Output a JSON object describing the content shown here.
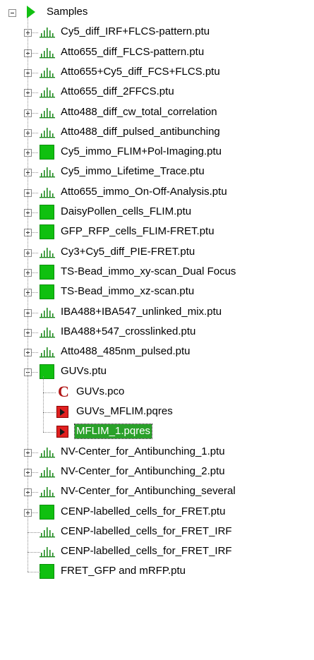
{
  "tree": {
    "root": {
      "label": "Samples",
      "expanded": true,
      "icon": "play-triangle-icon"
    },
    "items": [
      {
        "label": "Cy5_diff_IRF+FLCS-pattern.ptu",
        "icon": "histogram-icon"
      },
      {
        "label": "Atto655_diff_FLCS-pattern.ptu",
        "icon": "histogram-icon"
      },
      {
        "label": "Atto655+Cy5_diff_FCS+FLCS.ptu",
        "icon": "histogram-icon"
      },
      {
        "label": "Atto655_diff_2FFCS.ptu",
        "icon": "histogram-icon"
      },
      {
        "label": "Atto488_diff_cw_total_correlation",
        "icon": "histogram-icon"
      },
      {
        "label": "Atto488_diff_pulsed_antibunching",
        "icon": "histogram-icon"
      },
      {
        "label": "Cy5_immo_FLIM+Pol-Imaging.ptu",
        "icon": "image-icon"
      },
      {
        "label": "Cy5_immo_Lifetime_Trace.ptu",
        "icon": "histogram-icon"
      },
      {
        "label": "Atto655_immo_On-Off-Analysis.ptu",
        "icon": "histogram-icon"
      },
      {
        "label": "DaisyPollen_cells_FLIM.ptu",
        "icon": "image-icon"
      },
      {
        "label": "GFP_RFP_cells_FLIM-FRET.ptu",
        "icon": "image-icon"
      },
      {
        "label": "Cy3+Cy5_diff_PIE-FRET.ptu",
        "icon": "histogram-icon"
      },
      {
        "label": "TS-Bead_immo_xy-scan_Dual Focus",
        "icon": "image-icon"
      },
      {
        "label": "TS-Bead_immo_xz-scan.ptu",
        "icon": "image-icon"
      },
      {
        "label": "IBA488+IBA547_unlinked_mix.ptu",
        "icon": "histogram-icon"
      },
      {
        "label": "IBA488+547_crosslinked.ptu",
        "icon": "histogram-icon"
      },
      {
        "label": "Atto488_485nm_pulsed.ptu",
        "icon": "histogram-icon"
      },
      {
        "label": "GUVs.ptu",
        "icon": "image-icon",
        "expanded": true,
        "children": [
          {
            "label": "GUVs.pco",
            "icon": "pco-icon"
          },
          {
            "label": "GUVs_MFLIM.pqres",
            "icon": "pqres-icon"
          },
          {
            "label": "MFLIM_1.pqres",
            "icon": "pqres-icon",
            "selected": true
          }
        ]
      },
      {
        "label": "NV-Center_for_Antibunching_1.ptu",
        "icon": "histogram-icon"
      },
      {
        "label": "NV-Center_for_Antibunching_2.ptu",
        "icon": "histogram-icon"
      },
      {
        "label": "NV-Center_for_Antibunching_several",
        "icon": "histogram-icon"
      },
      {
        "label": "CENP-labelled_cells_for_FRET.ptu",
        "icon": "image-icon"
      },
      {
        "label": "CENP-labelled_cells_for_FRET_IRF",
        "icon": "histogram-icon",
        "leaf": true
      },
      {
        "label": "CENP-labelled_cells_for_FRET_IRF",
        "icon": "histogram-icon",
        "leaf": true
      },
      {
        "label": "FRET_GFP and mRFP.ptu",
        "icon": "image-icon",
        "leaf": true
      }
    ]
  },
  "colors": {
    "image_icon": "#10c010",
    "histogram_icon": "#1e8a1e",
    "selection": "#2aa12a",
    "pco": "#b01515"
  }
}
